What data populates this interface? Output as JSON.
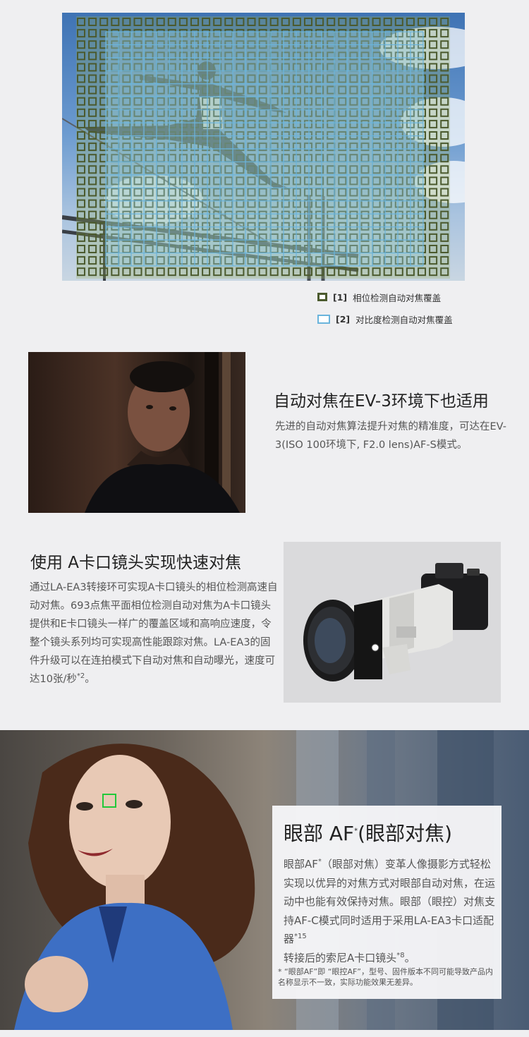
{
  "af_coverage": {
    "legend": [
      {
        "num": "[1]",
        "label": "相位检测自动对焦覆盖",
        "color": "#4b5a2e"
      },
      {
        "num": "[2]",
        "label": "对比度检测自动对焦覆盖",
        "color": "#6ab4dc"
      }
    ]
  },
  "low_light": {
    "title": "自动对焦在EV-3环境下也适用",
    "body": "先进的自动对焦算法提升对焦的精准度，可达在EV-3(ISO 100环境下, F2.0 lens)AF-S模式。"
  },
  "a_mount": {
    "title": "使用 A卡口镜头实现快速对焦",
    "body": "通过LA-EA3转接环可实现A卡口镜头的相位检测高速自动对焦。693点焦平面相位检测自动对焦为A卡口镜头提供和E卡口镜头一样广的覆盖区域和高响应速度，令整个镜头系列均可实现高性能跟踪对焦。LA-EA3的固件升级可以在连拍模式下自动对焦和自动曝光，速度可达10张/秒",
    "body_sup": "*2",
    "body_end": "。"
  },
  "eye_af": {
    "title_main": "眼部 AF",
    "title_sup": "*",
    "title_paren": "(眼部对焦)",
    "body_1": "眼部AF",
    "body_1_sup": "*",
    "body_2": "（眼部对焦）变革人像摄影方式轻松实现以优异的对焦方式对眼部自动对焦，在运动中也能有效保持对焦。眼部（眼控）对焦支持AF-C模式同时适用于采用LA-EA3卡口适配器",
    "body_2_sup": "*15",
    "body_3": "转接后的索尼A卡口镜头",
    "body_3_sup": "*8",
    "body_4": "。",
    "note": "* “眼部AF”即 “眼控AF”，型号、固件版本不同可能导致产品内名称显示不一致，实际功能效果无差异。",
    "focus_box_color": "#22c83a"
  }
}
